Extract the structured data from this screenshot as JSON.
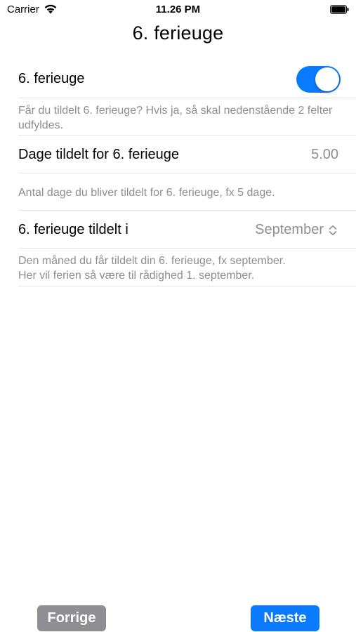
{
  "status_bar": {
    "carrier": "Carrier",
    "time": "11.26 PM",
    "wifi_icon": "wifi-icon",
    "battery_icon": "battery-icon"
  },
  "nav": {
    "title": "6. ferieuge"
  },
  "form": {
    "toggle_row": {
      "label": "6. ferieuge",
      "enabled": true,
      "hint": "Får du tildelt 6. ferieuge? Hvis ja, så skal nedenstående 2 felter udfyldes."
    },
    "days_row": {
      "label": "Dage tildelt for 6. ferieuge",
      "value": "5.00",
      "hint": "Antal dage du bliver tildelt for 6. ferieuge, fx 5 dage."
    },
    "month_row": {
      "label": "6. ferieuge tildelt i",
      "value": "September",
      "hint_line1": "Den måned du får tildelt din 6. ferieuge, fx september.",
      "hint_line2": "Her vil ferien så være til rådighed 1. september."
    }
  },
  "buttons": {
    "previous": "Forrige",
    "next": "Næste"
  },
  "colors": {
    "accent": "#0a7bff",
    "secondary_text": "#8e8e93",
    "disabled_button": "#8e8e93",
    "separator": "#e5e5ea"
  }
}
